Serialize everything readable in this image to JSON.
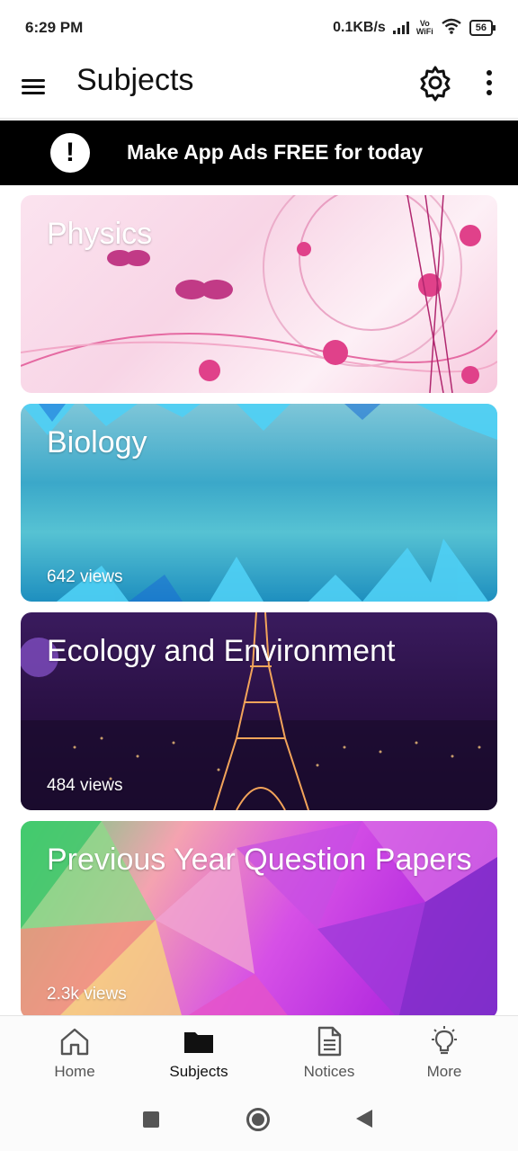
{
  "status_bar": {
    "time": "6:29 PM",
    "speed": "0.1KB/s",
    "vowifi_top": "Vo",
    "vowifi_bottom": "WiFi",
    "battery": "56"
  },
  "app_bar": {
    "title": "Subjects",
    "menu_icon": "hamburger-menu-icon",
    "settings_icon": "gear-icon",
    "more_icon": "more-vert-icon"
  },
  "ad_banner": {
    "icon": "!",
    "text": "Make App Ads FREE for today"
  },
  "subjects": [
    {
      "title": "Physics",
      "views": "",
      "theme": "pink-floral"
    },
    {
      "title": "Biology",
      "views": "642 views",
      "theme": "teal-crystal"
    },
    {
      "title": "Ecology and Environment",
      "views": "484 views",
      "theme": "night-city"
    },
    {
      "title": "Previous Year Question Papers",
      "views": "2.3k views",
      "theme": "polygon-colorful"
    }
  ],
  "bottom_nav": [
    {
      "label": "Home",
      "icon": "home-icon",
      "active": false
    },
    {
      "label": "Subjects",
      "icon": "folder-icon",
      "active": true
    },
    {
      "label": "Notices",
      "icon": "document-icon",
      "active": false
    },
    {
      "label": "More",
      "icon": "lightbulb-icon",
      "active": false
    }
  ],
  "colors": {
    "ad_background": "#000000",
    "active_nav": "#111111",
    "inactive_nav": "#555555"
  }
}
